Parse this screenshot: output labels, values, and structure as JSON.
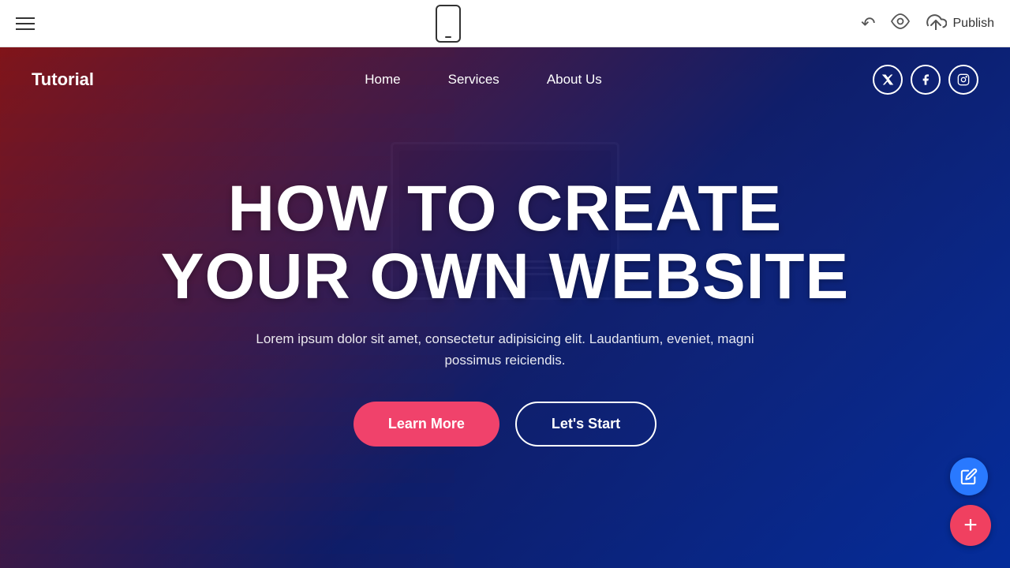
{
  "toolbar": {
    "hamburger_icon": "hamburger-menu",
    "phone_icon": "mobile-preview",
    "undo_icon": "undo",
    "eye_icon": "preview",
    "cloud_icon": "cloud-upload",
    "publish_label": "Publish"
  },
  "site": {
    "logo": "Tutorial",
    "nav": {
      "links": [
        {
          "label": "Home",
          "id": "home"
        },
        {
          "label": "Services",
          "id": "services"
        },
        {
          "label": "About Us",
          "id": "about"
        }
      ]
    },
    "social": [
      {
        "icon": "twitter",
        "symbol": "𝕏"
      },
      {
        "icon": "facebook",
        "symbol": "f"
      },
      {
        "icon": "instagram",
        "symbol": "📷"
      }
    ],
    "hero": {
      "title_line1": "HOW TO CREATE",
      "title_line2": "YOUR OWN WEBSITE",
      "description": "Lorem ipsum dolor sit amet, consectetur adipisicing elit. Laudantium, eveniet, magni possimus reiciendis.",
      "btn_learn_more": "Learn More",
      "btn_lets_start": "Let's Start"
    }
  },
  "fab": {
    "pencil_icon": "edit",
    "plus_icon": "add"
  }
}
